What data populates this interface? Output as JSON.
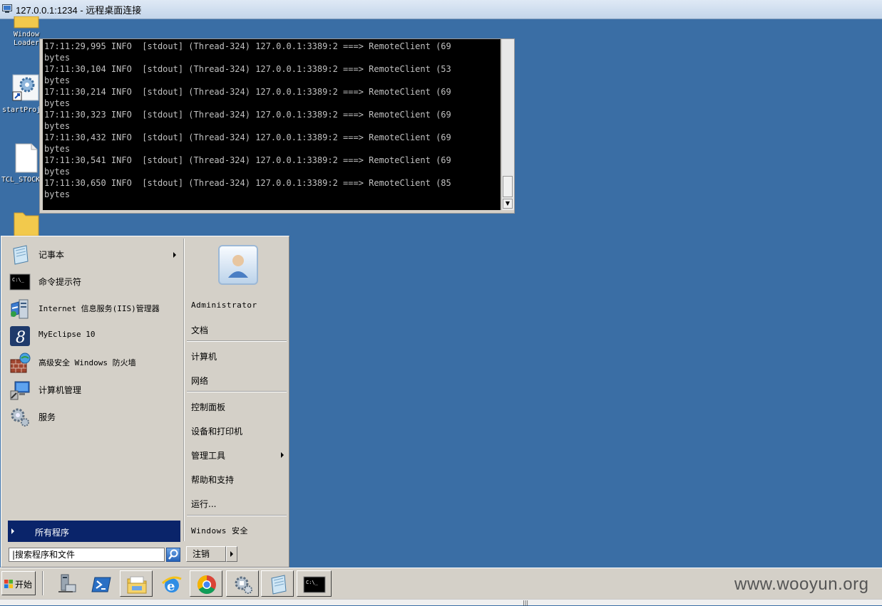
{
  "window": {
    "title": "127.0.0.1:1234 - 远程桌面连接"
  },
  "desktop_icons": [
    {
      "label": "Windows Loader",
      "label_line1": "Window",
      "label_line2": "Loader",
      "icon": "folder-icon"
    },
    {
      "label": "startProj",
      "icon": "gear-shortcut-icon"
    },
    {
      "label": "TCL_STOCK",
      "icon": "document-icon"
    },
    {
      "label": "",
      "icon": "folder-icon"
    }
  ],
  "console": {
    "lines": [
      "17:11:29,995 INFO  [stdout] (Thread-324) 127.0.0.1:3389:2 ===> RemoteClient (69",
      "bytes",
      "17:11:30,104 INFO  [stdout] (Thread-324) 127.0.0.1:3389:2 ===> RemoteClient (53",
      "bytes",
      "17:11:30,214 INFO  [stdout] (Thread-324) 127.0.0.1:3389:2 ===> RemoteClient (69",
      "bytes",
      "17:11:30,323 INFO  [stdout] (Thread-324) 127.0.0.1:3389:2 ===> RemoteClient (69",
      "bytes",
      "17:11:30,432 INFO  [stdout] (Thread-324) 127.0.0.1:3389:2 ===> RemoteClient (69",
      "bytes",
      "17:11:30,541 INFO  [stdout] (Thread-324) 127.0.0.1:3389:2 ===> RemoteClient (69",
      "bytes",
      "17:11:30,650 INFO  [stdout] (Thread-324) 127.0.0.1:3389:2 ===> RemoteClient (85",
      "bytes"
    ]
  },
  "start_menu": {
    "programs": [
      {
        "label": "记事本",
        "icon": "notepad-icon",
        "has_submenu": true
      },
      {
        "label": "命令提示符",
        "icon": "cmd-icon",
        "has_submenu": false
      },
      {
        "label": "Internet 信息服务(IIS)管理器",
        "icon": "iis-manager-icon",
        "has_submenu": false
      },
      {
        "label": "MyEclipse 10",
        "icon": "myeclipse-icon",
        "has_submenu": false
      },
      {
        "label": "高级安全 Windows 防火墙",
        "icon": "firewall-icon",
        "has_submenu": false
      },
      {
        "label": "计算机管理",
        "icon": "computer-management-icon",
        "has_submenu": false
      },
      {
        "label": "服务",
        "icon": "services-gear-icon",
        "has_submenu": false
      }
    ],
    "all_programs_label": "所有程序",
    "search_placeholder": "搜索程序和文件",
    "user_name": "Administrator",
    "places": {
      "documents": "文档",
      "computer": "计算机",
      "network": "网络",
      "control_panel": "控制面板",
      "devices_printers": "设备和打印机",
      "admin_tools": "管理工具",
      "help_support": "帮助和支持",
      "run": "运行...",
      "windows_security": "Windows 安全"
    },
    "logoff_label": "注销"
  },
  "taskbar": {
    "start_label": "开始",
    "buttons": [
      {
        "name": "server-manager",
        "icon": "server-manager-icon"
      },
      {
        "name": "powershell",
        "icon": "powershell-icon"
      },
      {
        "name": "explorer",
        "icon": "explorer-folder-icon"
      },
      {
        "name": "internet-explorer",
        "icon": "internet-explorer-icon"
      },
      {
        "name": "chrome",
        "icon": "chrome-icon"
      },
      {
        "name": "control-panel",
        "icon": "control-panel-icon"
      },
      {
        "name": "notepad",
        "icon": "notepad-icon"
      },
      {
        "name": "cmd",
        "icon": "cmd-icon"
      }
    ]
  },
  "watermark": "www.wooyun.org"
}
